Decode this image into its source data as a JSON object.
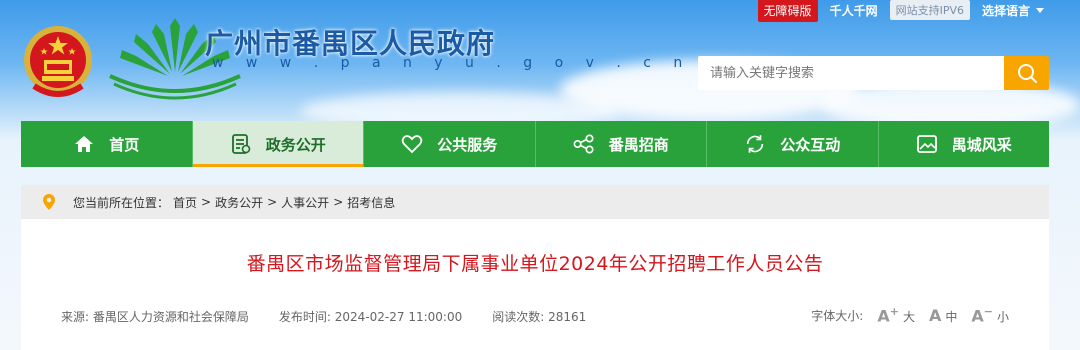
{
  "header": {
    "title": "广州市番禺区人民政府",
    "url": "w w w . p a n y u . g o v . c n",
    "top_links": {
      "accessibility": "无障碍版",
      "qianren": "千人千网",
      "ipv6": "网站支持IPV6",
      "language": "选择语言"
    },
    "search": {
      "placeholder": "请输入关键字搜索"
    }
  },
  "nav": {
    "items": [
      {
        "label": "首页",
        "icon": "home-icon"
      },
      {
        "label": "政务公开",
        "icon": "document-icon",
        "active": true
      },
      {
        "label": "公共服务",
        "icon": "heart-icon"
      },
      {
        "label": "番禺招商",
        "icon": "network-icon"
      },
      {
        "label": "公众互动",
        "icon": "refresh-icon"
      },
      {
        "label": "禺城风采",
        "icon": "picture-icon"
      }
    ]
  },
  "breadcrumb": {
    "prefix": "您当前所在位置：",
    "items": [
      "首页",
      "政务公开",
      "人事公开",
      "招考信息"
    ]
  },
  "article": {
    "title": "番禺区市场监督管理局下属事业单位2024年公开招聘工作人员公告",
    "source_label": "来源:",
    "source": "番禺区人力资源和社会保障局",
    "date_label": "发布时间:",
    "date": "2024-02-27 11:00:00",
    "views_label": "阅读次数:",
    "views": "28161",
    "font_size_label": "字体大小:",
    "font_sizes": [
      "大",
      "中",
      "小"
    ]
  },
  "colors": {
    "nav_green": "#2aa23b",
    "accent_orange": "#f8a500",
    "title_red": "#d4161d",
    "brand_blue": "#1b5aa5"
  }
}
